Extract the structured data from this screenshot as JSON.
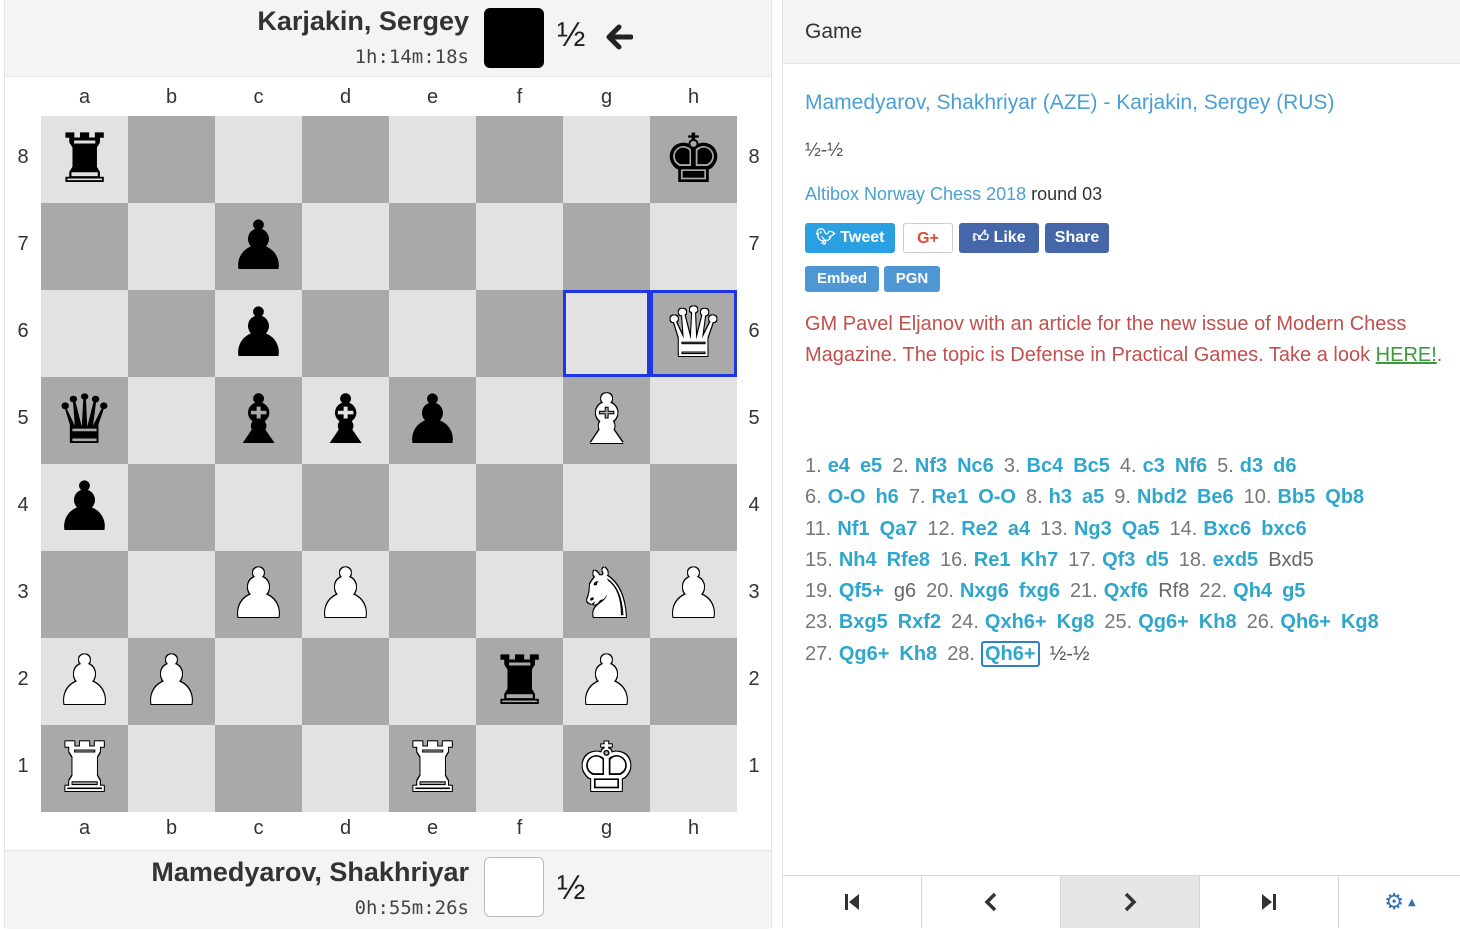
{
  "top_player": {
    "name": "Karjakin, Sergey",
    "clock": "1h:14m:18s",
    "score": "½",
    "color": "black"
  },
  "bottom_player": {
    "name": "Mamedyarov, Shakhriyar",
    "clock": "0h:55m:26s",
    "score": "½",
    "color": "white"
  },
  "board": {
    "files": [
      "a",
      "b",
      "c",
      "d",
      "e",
      "f",
      "g",
      "h"
    ],
    "ranks": [
      "8",
      "7",
      "6",
      "5",
      "4",
      "3",
      "2",
      "1"
    ],
    "highlighted_squares": [
      "g6",
      "h6"
    ],
    "pieces": [
      {
        "square": "a8",
        "piece": "rook",
        "color": "black"
      },
      {
        "square": "h8",
        "piece": "king",
        "color": "black"
      },
      {
        "square": "c7",
        "piece": "pawn",
        "color": "black"
      },
      {
        "square": "c6",
        "piece": "pawn",
        "color": "black"
      },
      {
        "square": "h6",
        "piece": "queen",
        "color": "white"
      },
      {
        "square": "a5",
        "piece": "queen",
        "color": "black"
      },
      {
        "square": "c5",
        "piece": "bishop",
        "color": "black"
      },
      {
        "square": "d5",
        "piece": "bishop",
        "color": "black"
      },
      {
        "square": "e5",
        "piece": "pawn",
        "color": "black"
      },
      {
        "square": "g5",
        "piece": "bishop",
        "color": "white"
      },
      {
        "square": "a4",
        "piece": "pawn",
        "color": "black"
      },
      {
        "square": "c3",
        "piece": "pawn",
        "color": "white"
      },
      {
        "square": "d3",
        "piece": "pawn",
        "color": "white"
      },
      {
        "square": "g3",
        "piece": "knight",
        "color": "white"
      },
      {
        "square": "h3",
        "piece": "pawn",
        "color": "white"
      },
      {
        "square": "a2",
        "piece": "pawn",
        "color": "white"
      },
      {
        "square": "b2",
        "piece": "pawn",
        "color": "white"
      },
      {
        "square": "f2",
        "piece": "rook",
        "color": "black"
      },
      {
        "square": "g2",
        "piece": "pawn",
        "color": "white"
      },
      {
        "square": "a1",
        "piece": "rook",
        "color": "white"
      },
      {
        "square": "e1",
        "piece": "rook",
        "color": "white"
      },
      {
        "square": "g1",
        "piece": "king",
        "color": "white"
      }
    ]
  },
  "game_panel": {
    "title": "Game",
    "white_player": "Mamedyarov, Shakhriyar (AZE)",
    "separator": " - ",
    "black_player": "Karjakin, Sergey (RUS)",
    "result": "½-½",
    "event": "Altibox Norway Chess 2018",
    "round": "round 03",
    "share": {
      "tweet": "Tweet",
      "gplus": "G+",
      "like": "Like",
      "share": "Share",
      "embed": "Embed",
      "pgn": "PGN"
    },
    "promo": {
      "text": "GM Pavel Eljanov with an article for the new issue of Modern Chess Magazine. The topic is Defense in Practical Games. Take a look ",
      "link": "HERE!",
      "end": "."
    },
    "moves": [
      [
        [
          "1.",
          "e4",
          "e5"
        ],
        [
          "2.",
          "Nf3",
          "Nc6"
        ],
        [
          "3.",
          "Bc4",
          "Bc5"
        ],
        [
          "4.",
          "c3",
          "Nf6"
        ],
        [
          "5.",
          "d3",
          "d6"
        ]
      ],
      [
        [
          "6.",
          "O-O",
          "h6"
        ],
        [
          "7.",
          "Re1",
          "O-O"
        ],
        [
          "8.",
          "h3",
          "a5"
        ],
        [
          "9.",
          "Nbd2",
          "Be6"
        ],
        [
          "10.",
          "Bb5",
          "Qb8"
        ]
      ],
      [
        [
          "11.",
          "Nf1",
          "Qa7"
        ],
        [
          "12.",
          "Re2",
          "a4"
        ],
        [
          "13.",
          "Ng3",
          "Qa5"
        ],
        [
          "14.",
          "Bxc6",
          "bxc6"
        ]
      ],
      [
        [
          "15.",
          "Nh4",
          "Rfe8"
        ],
        [
          "16.",
          "Re1",
          "Kh7"
        ],
        [
          "17.",
          "Qf3",
          "d5"
        ],
        [
          "18.",
          "exd5",
          "Bxd5"
        ]
      ],
      [
        [
          "19.",
          "Qf5+",
          "g6"
        ],
        [
          "20.",
          "Nxg6",
          "fxg6"
        ],
        [
          "21.",
          "Qxf6",
          "Rf8"
        ],
        [
          "22.",
          "Qh4",
          "g5"
        ]
      ],
      [
        [
          "23.",
          "Bxg5",
          "Rxf2"
        ],
        [
          "24.",
          "Qxh6+",
          "Kg8"
        ],
        [
          "25.",
          "Qg6+",
          "Kh8"
        ],
        [
          "26.",
          "Qh6+",
          "Kg8"
        ]
      ],
      [
        [
          "27.",
          "Qg6+",
          "Kh8"
        ],
        [
          "28.",
          "Qh6+",
          ""
        ]
      ]
    ],
    "dim_moves": [
      "Bxd5",
      "g6",
      "Rf8"
    ],
    "current_move": "Qh6+",
    "final_result": "½-½",
    "nav": [
      "first-move",
      "previous-move",
      "next-move",
      "last-move",
      "settings"
    ]
  },
  "colors": {
    "accent": "#2fa6cc",
    "highlight": "#1e36e6",
    "promo": "#c0504d",
    "twitter": "#2a9fe1",
    "facebook": "#4566a8"
  }
}
